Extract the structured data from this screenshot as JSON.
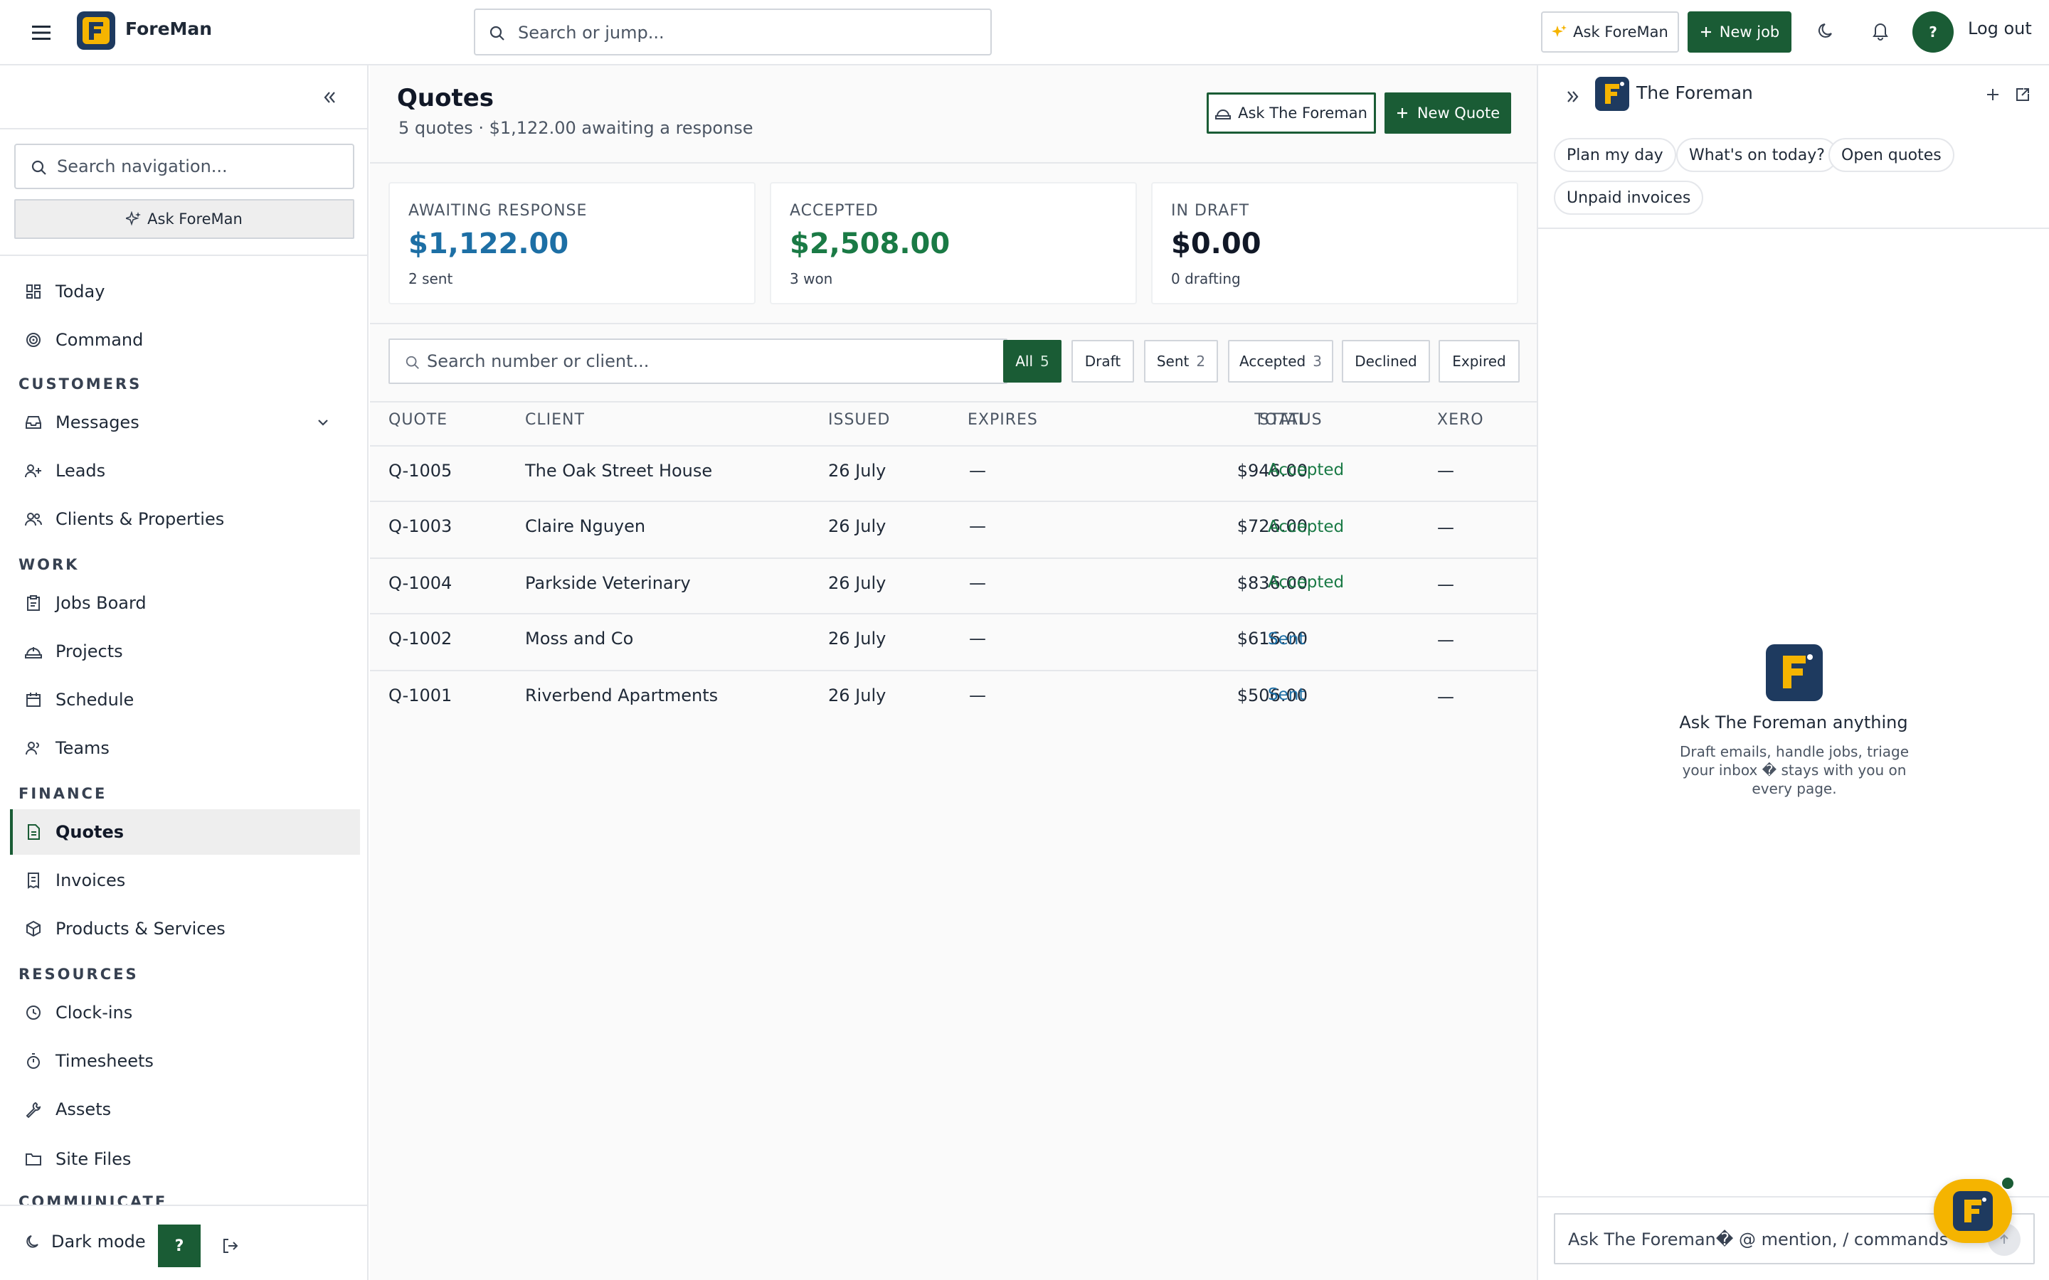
{
  "app": {
    "brand": "ForeMan",
    "top_search_placeholder": "Search or jump...",
    "ask_button": "Ask ForeMan",
    "new_job_button": "New job",
    "avatar_label": "?",
    "logout": "Log out"
  },
  "sidebar": {
    "search_placeholder": "Search navigation...",
    "ask_button": "Ask ForeMan",
    "items_top": [
      {
        "label": "Today",
        "icon": "dashboard-icon"
      },
      {
        "label": "Command",
        "icon": "target-icon"
      }
    ],
    "sections": {
      "customers": "CUSTOMERS",
      "work": "WORK",
      "finance": "FINANCE",
      "resources": "RESOURCES",
      "communicate": "COMMUNICATE"
    },
    "customers": [
      {
        "label": "Messages",
        "icon": "inbox-icon"
      },
      {
        "label": "Leads",
        "icon": "user-plus-icon"
      },
      {
        "label": "Clients & Properties",
        "icon": "users-icon"
      }
    ],
    "work": [
      {
        "label": "Jobs Board",
        "icon": "clipboard-icon"
      },
      {
        "label": "Projects",
        "icon": "hard-hat-icon"
      },
      {
        "label": "Schedule",
        "icon": "calendar-icon"
      },
      {
        "label": "Teams",
        "icon": "team-icon"
      }
    ],
    "finance": [
      {
        "label": "Quotes",
        "icon": "file-text-icon",
        "active": true
      },
      {
        "label": "Invoices",
        "icon": "receipt-icon"
      },
      {
        "label": "Products & Services",
        "icon": "box-icon"
      }
    ],
    "resources": [
      {
        "label": "Clock-ins",
        "icon": "clock-icon"
      },
      {
        "label": "Timesheets",
        "icon": "timer-icon"
      },
      {
        "label": "Assets",
        "icon": "wrench-icon"
      },
      {
        "label": "Site Files",
        "icon": "folder-icon"
      }
    ],
    "dark_mode": "Dark mode",
    "help_label": "?"
  },
  "main": {
    "title": "Quotes",
    "subtitle": "5 quotes · $1,122.00 awaiting a response",
    "ask_button": "Ask The Foreman",
    "new_button": "New Quote",
    "stats": [
      {
        "label": "AWAITING RESPONSE",
        "value": "$1,122.00",
        "note": "2 sent",
        "color": "#1d6fa5"
      },
      {
        "label": "ACCEPTED",
        "value": "$2,508.00",
        "note": "3 won",
        "color": "#1a7a45"
      },
      {
        "label": "IN DRAFT",
        "value": "$0.00",
        "note": "0 drafting",
        "color": "#111827"
      }
    ],
    "filter_placeholder": "Search number or client...",
    "filters": [
      {
        "label": "All",
        "count": "5",
        "active": true
      },
      {
        "label": "Draft",
        "count": ""
      },
      {
        "label": "Sent",
        "count": "2"
      },
      {
        "label": "Accepted",
        "count": "3"
      },
      {
        "label": "Declined",
        "count": ""
      },
      {
        "label": "Expired",
        "count": ""
      }
    ],
    "columns": [
      "QUOTE",
      "CLIENT",
      "ISSUED",
      "EXPIRES",
      "TOTAL",
      "STATUS",
      "XERO"
    ],
    "rows": [
      {
        "quote": "Q-1005",
        "client": "The Oak Street House",
        "issued": "26 July",
        "expires": "—",
        "total": "$946.00",
        "status": "Accepted",
        "xero": "—"
      },
      {
        "quote": "Q-1003",
        "client": "Claire Nguyen",
        "issued": "26 July",
        "expires": "—",
        "total": "$726.00",
        "status": "Accepted",
        "xero": "—"
      },
      {
        "quote": "Q-1004",
        "client": "Parkside Veterinary",
        "issued": "26 July",
        "expires": "—",
        "total": "$836.00",
        "status": "Accepted",
        "xero": "—"
      },
      {
        "quote": "Q-1002",
        "client": "Moss and Co",
        "issued": "26 July",
        "expires": "—",
        "total": "$616.00",
        "status": "Sent",
        "xero": "—"
      },
      {
        "quote": "Q-1001",
        "client": "Riverbend Apartments",
        "issued": "26 July",
        "expires": "—",
        "total": "$506.00",
        "status": "Sent",
        "xero": "—"
      }
    ]
  },
  "assistant": {
    "title": "The Foreman",
    "chips": [
      "Plan my day",
      "What's on today?",
      "Open quotes",
      "Unpaid invoices"
    ],
    "empty_title": "Ask The Foreman anything",
    "empty_desc": "Draft emails, handle jobs, triage your inbox � stays with you on every page.",
    "input_placeholder": "Ask The Foreman� @ mention, / commands"
  },
  "colors": {
    "brand_green": "#1a5c35",
    "brand_yellow": "#f5b400",
    "accepted": "#1a7a45",
    "sent": "#1d6fa5"
  }
}
